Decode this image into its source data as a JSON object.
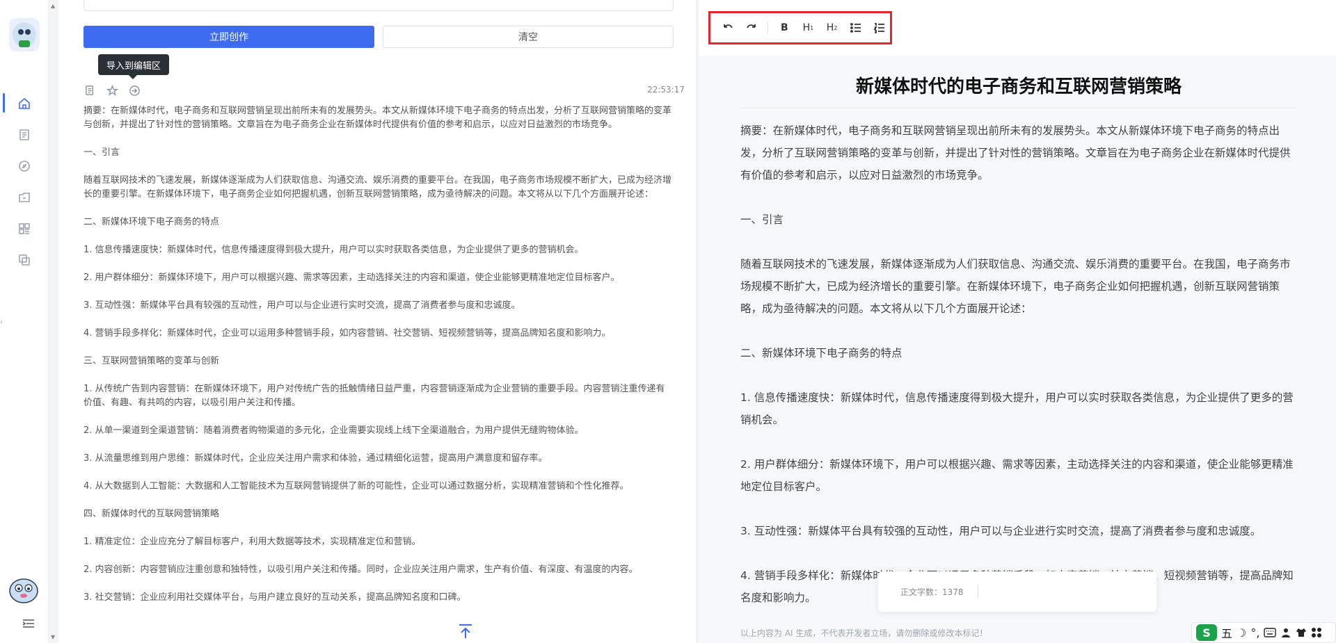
{
  "nav": {
    "items": [
      "home-icon",
      "document-icon",
      "compass-icon",
      "folder-icon",
      "apps-icon",
      "copy-icon"
    ]
  },
  "left": {
    "create_label": "立即创作",
    "clear_label": "清空",
    "tooltip": "导入到编辑区",
    "timestamp": "22:53:17",
    "paragraphs": [
      "摘要：在新媒体时代，电子商务和互联网营销呈现出前所未有的发展势头。本文从新媒体环境下电子商务的特点出发，分析了互联网营销策略的变革与创新，并提出了针对性的营销策略。文章旨在为电子商务企业在新媒体时代提供有价值的参考和启示，以应对日益激烈的市场竞争。",
      "一、引言",
      "随着互联网技术的飞速发展，新媒体逐渐成为人们获取信息、沟通交流、娱乐消费的重要平台。在我国，电子商务市场规模不断扩大，已成为经济增长的重要引擎。在新媒体环境下，电子商务企业如何把握机遇，创新互联网营销策略，成为亟待解决的问题。本文将从以下几个方面展开论述：",
      "二、新媒体环境下电子商务的特点",
      "1. 信息传播速度快：新媒体时代，信息传播速度得到极大提升，用户可以实时获取各类信息，为企业提供了更多的营销机会。",
      "2. 用户群体细分：新媒体环境下，用户可以根据兴趣、需求等因素，主动选择关注的内容和渠道，使企业能够更精准地定位目标客户。",
      "3. 互动性强：新媒体平台具有较强的互动性，用户可以与企业进行实时交流，提高了消费者参与度和忠诚度。",
      "4. 营销手段多样化：新媒体时代，企业可以运用多种营销手段，如内容营销、社交营销、短视频营销等，提高品牌知名度和影响力。",
      "三、互联网营销策略的变革与创新",
      "1. 从传统广告到内容营销：在新媒体环境下，用户对传统广告的抵触情绪日益严重，内容营销逐渐成为企业营销的重要手段。内容营销注重传递有价值、有趣、有共鸣的内容，以吸引用户关注和传播。",
      "2. 从单一渠道到全渠道营销：随着消费者购物渠道的多元化，企业需要实现线上线下全渠道融合，为用户提供无缝购物体验。",
      "3. 从流量思维到用户思维：新媒体时代，企业应关注用户需求和体验，通过精细化运营，提高用户满意度和留存率。",
      "4. 从大数据到人工智能：大数据和人工智能技术为互联网营销提供了新的可能性，企业可以通过数据分析，实现精准营销和个性化推荐。",
      "四、新媒体时代的互联网营销策略",
      "1. 精准定位：企业应充分了解目标客户，利用大数据等技术，实现精准定位和营销。",
      "2. 内容创新：内容营销应注重创意和独特性，以吸引用户关注和传播。同时，企业应关注用户需求，生产有价值、有深度、有温度的内容。",
      "3. 社交营销：企业应利用社交媒体平台，与用户建立良好的互动关系，提高品牌知名度和口碑。"
    ]
  },
  "right": {
    "toolbar": [
      "undo-icon",
      "redo-icon",
      "bold-button",
      "heading1-button",
      "heading2-button",
      "bullet-list-icon",
      "ordered-list-icon"
    ],
    "bold_label": "B",
    "h1_label": "H",
    "h1_sub": "1",
    "h2_label": "H",
    "h2_sub": "2",
    "doc_title": "新媒体时代的电子商务和互联网营销策略",
    "paragraphs": [
      "摘要：在新媒体时代，电子商务和互联网营销呈现出前所未有的发展势头。本文从新媒体环境下电子商务的特点出发，分析了互联网营销策略的变革与创新，并提出了针对性的营销策略。文章旨在为电子商务企业在新媒体时代提供有价值的参考和启示，以应对日益激烈的市场竞争。",
      "一、引言",
      "随着互联网技术的飞速发展，新媒体逐渐成为人们获取信息、沟通交流、娱乐消费的重要平台。在我国，电子商务市场规模不断扩大，已成为经济增长的重要引擎。在新媒体环境下，电子商务企业如何把握机遇，创新互联网营销策略，成为亟待解决的问题。本文将从以下几个方面展开论述：",
      "二、新媒体环境下电子商务的特点",
      "1. 信息传播速度快：新媒体时代，信息传播速度得到极大提升，用户可以实时获取各类信息，为企业提供了更多的营销机会。",
      "2. 用户群体细分：新媒体环境下，用户可以根据兴趣、需求等因素，主动选择关注的内容和渠道，使企业能够更精准地定位目标客户。",
      "3. 互动性强：新媒体平台具有较强的互动性，用户可以与企业进行实时交流，提高了消费者参与度和忠诚度。",
      "4. 营销手段多样化：新媒体时代，企业可以运用多种营销手段，如内容营销、社交营销、短视频营销等，提高品牌知名度和影响力。"
    ],
    "word_count_label": "正文字数：1378",
    "disclaimer": "以上内容为 AI 生成，不代表开发者立场，请勿删除或修改本标记！"
  },
  "ime": {
    "logo": "S",
    "mode": "五",
    "moon": "☽",
    "punct": "°,"
  },
  "colors": {
    "accent": "#3d6cf0",
    "highlight_border": "#e8232a"
  }
}
